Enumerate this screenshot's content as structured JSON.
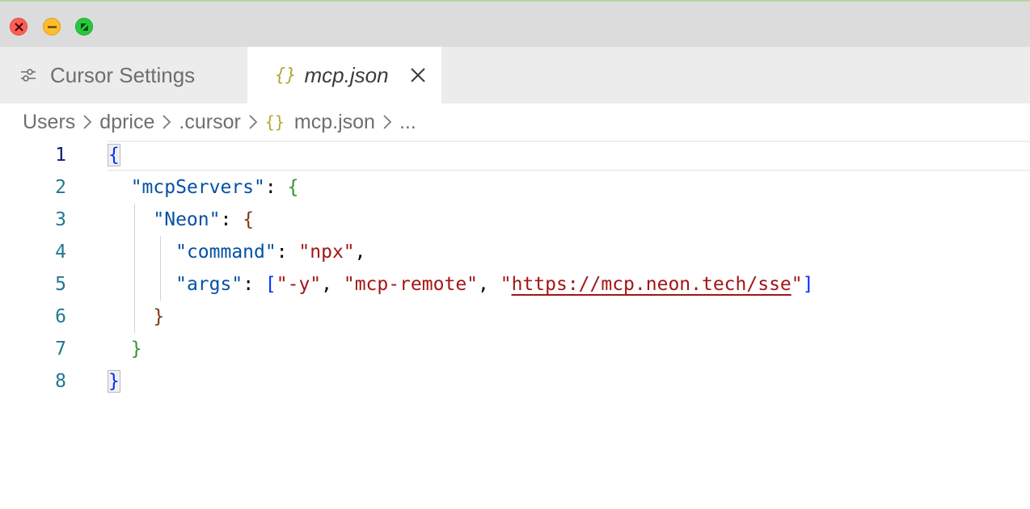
{
  "window": {
    "controls": [
      "close-icon",
      "minimize-icon",
      "maximize-icon"
    ]
  },
  "tabs": [
    {
      "label": "Cursor Settings",
      "icon": "sliders-icon",
      "active": false
    },
    {
      "label": "mcp.json",
      "icon": "json-braces-icon",
      "active": true,
      "glyph": "{}"
    }
  ],
  "breadcrumb": {
    "items": [
      "Users",
      "dprice",
      ".cursor",
      "mcp.json",
      "..."
    ],
    "json_glyph": "{}"
  },
  "editor": {
    "active_line": 1,
    "line_numbers": [
      "1",
      "2",
      "3",
      "4",
      "5",
      "6",
      "7",
      "8"
    ],
    "tokens": {
      "open_brace": "{",
      "close_brace": "}",
      "mcpServers_key": "\"mcpServers\"",
      "neon_key": "\"Neon\"",
      "command_key": "\"command\"",
      "command_value": "\"npx\"",
      "args_key": "\"args\"",
      "arg1": "\"-y\"",
      "arg2": "\"mcp-remote\"",
      "arg3_url": "https://mcp.neon.tech/sse",
      "colon": ": ",
      "comma": ", ",
      "line_comma": ",",
      "quote": "\"",
      "open_bracket": "[",
      "close_bracket": "]"
    }
  },
  "colors": {
    "key": "#0451a5",
    "string": "#a31515",
    "bracket_level1": "#0431fa",
    "bracket_level2": "#319331",
    "bracket_level3": "#7b3814",
    "line_number": "#237893"
  }
}
